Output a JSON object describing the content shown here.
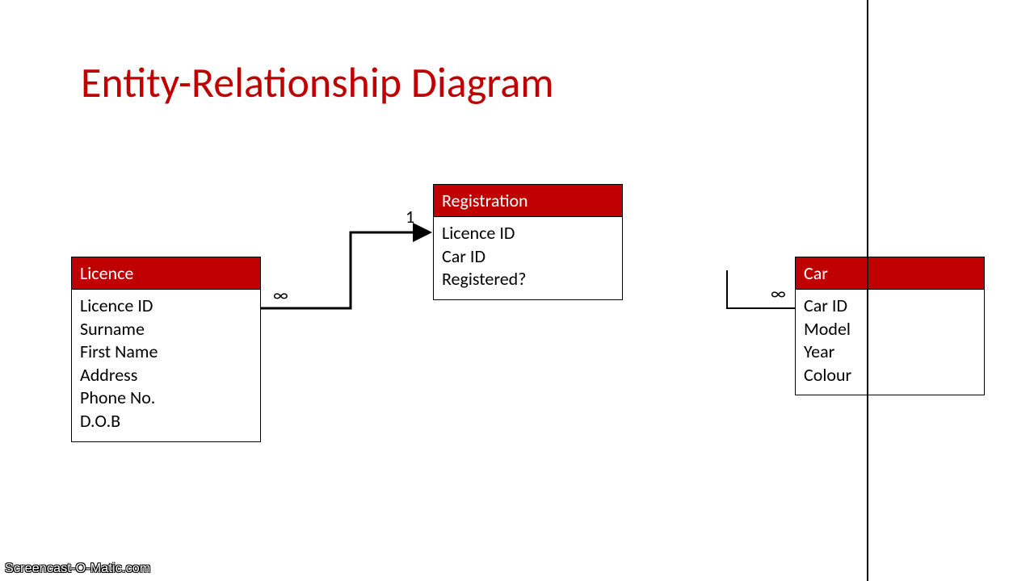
{
  "title": "Entity-Relationship Diagram",
  "entities": {
    "licence": {
      "name": "Licence",
      "attributes": [
        "Licence ID",
        "Surname",
        "First Name",
        "Address",
        "Phone No.",
        "D.O.B"
      ]
    },
    "registration": {
      "name": "Registration",
      "attributes": [
        "Licence ID",
        "Car ID",
        "Registered?"
      ]
    },
    "car": {
      "name": "Car",
      "attributes": [
        "Car ID",
        "Model",
        "Year",
        "Colour"
      ]
    }
  },
  "cardinalities": {
    "licence_side": "∞",
    "registration_side_left": "1",
    "car_side": "∞"
  },
  "watermark": "Screencast-O-Matic.com"
}
